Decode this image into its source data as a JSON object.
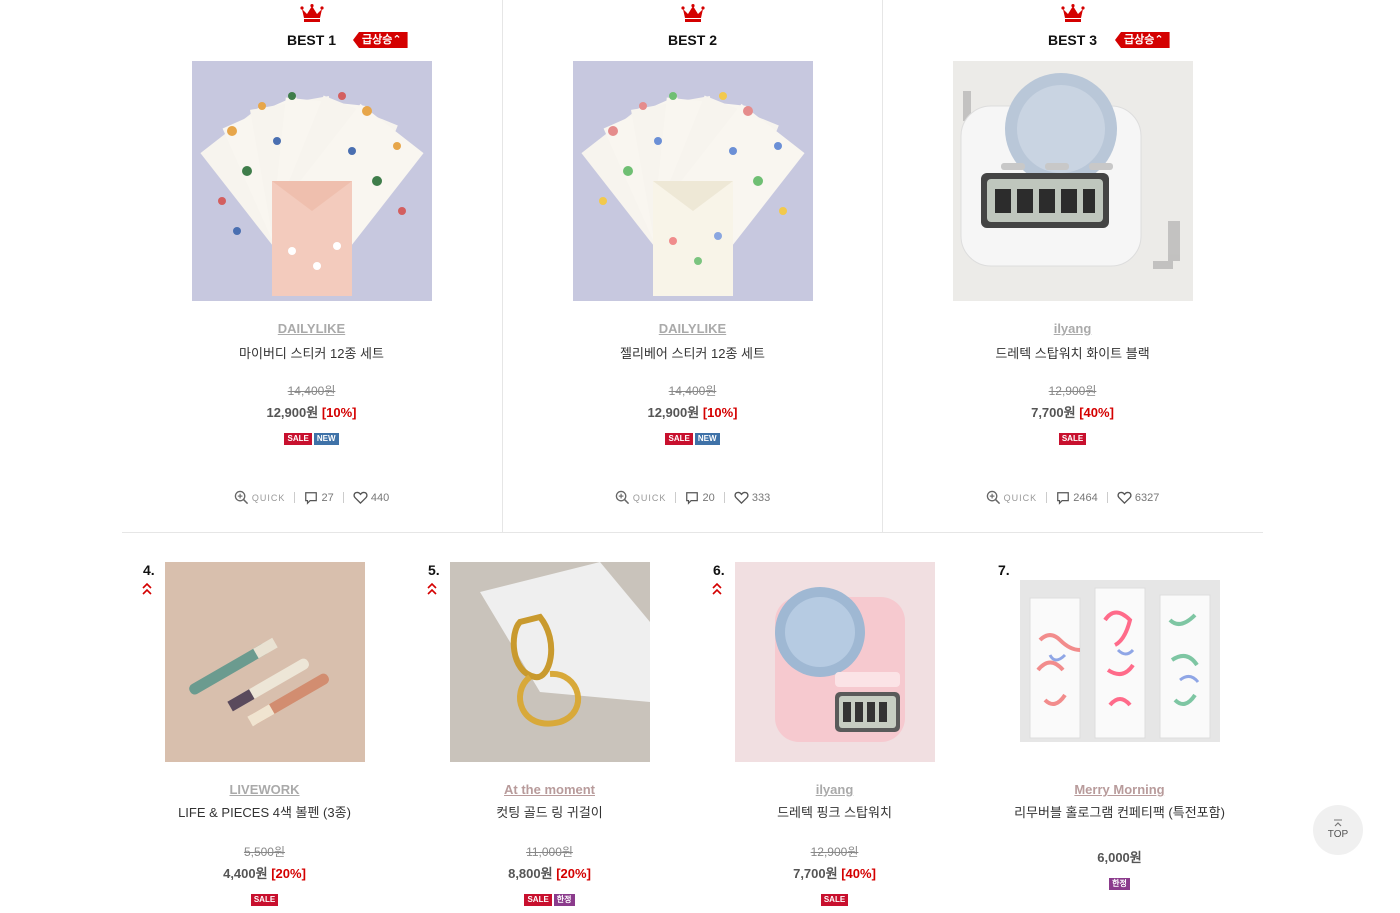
{
  "colors": {
    "accent_red": "#d40000",
    "sale": "#c8102e",
    "new": "#3f72a8",
    "limited": "#8b3b8c"
  },
  "best": [
    {
      "label": "BEST 1",
      "surge": "급상승",
      "brand": "DAILYLIKE",
      "name": "마이버디 스티커 12종 세트",
      "original_price": "14,400원",
      "price": "12,900원",
      "discount": "[10%]",
      "tags": [
        "SALE",
        "NEW"
      ],
      "quick": "QUICK",
      "comments": "27",
      "likes": "440"
    },
    {
      "label": "BEST 2",
      "surge": "",
      "brand": "DAILYLIKE",
      "name": "젤리베어 스티커 12종 세트",
      "original_price": "14,400원",
      "price": "12,900원",
      "discount": "[10%]",
      "tags": [
        "SALE",
        "NEW"
      ],
      "quick": "QUICK",
      "comments": "20",
      "likes": "333"
    },
    {
      "label": "BEST 3",
      "surge": "급상승",
      "brand": "ilyang",
      "name": "드레텍 스탑워치 화이트 블랙",
      "original_price": "12,900원",
      "price": "7,700원",
      "discount": "[40%]",
      "tags": [
        "SALE"
      ],
      "quick": "QUICK",
      "comments": "2464",
      "likes": "6327"
    }
  ],
  "ranked": [
    {
      "rank": "4.",
      "brand": "LIVEWORK",
      "name": "LIFE & PIECES 4색 볼펜 (3종)",
      "original_price": "5,500원",
      "price": "4,400원",
      "discount": "[20%]",
      "tags": [
        "SALE"
      ]
    },
    {
      "rank": "5.",
      "brand": "At the moment",
      "name": "컷팅 골드 링 귀걸이",
      "original_price": "11,000원",
      "price": "8,800원",
      "discount": "[20%]",
      "tags": [
        "SALE",
        "한정"
      ]
    },
    {
      "rank": "6.",
      "brand": "ilyang",
      "name": "드레텍 핑크 스탑워치",
      "original_price": "12,900원",
      "price": "7,700원",
      "discount": "[40%]",
      "tags": [
        "SALE"
      ]
    },
    {
      "rank": "7.",
      "brand": "Merry Morning",
      "name": "리무버블 홀로그램 컨페티팩 (특전포함)",
      "original_price": "",
      "price": "6,000원",
      "discount": "",
      "tags": [
        "한정"
      ]
    }
  ],
  "top_button": "TOP"
}
